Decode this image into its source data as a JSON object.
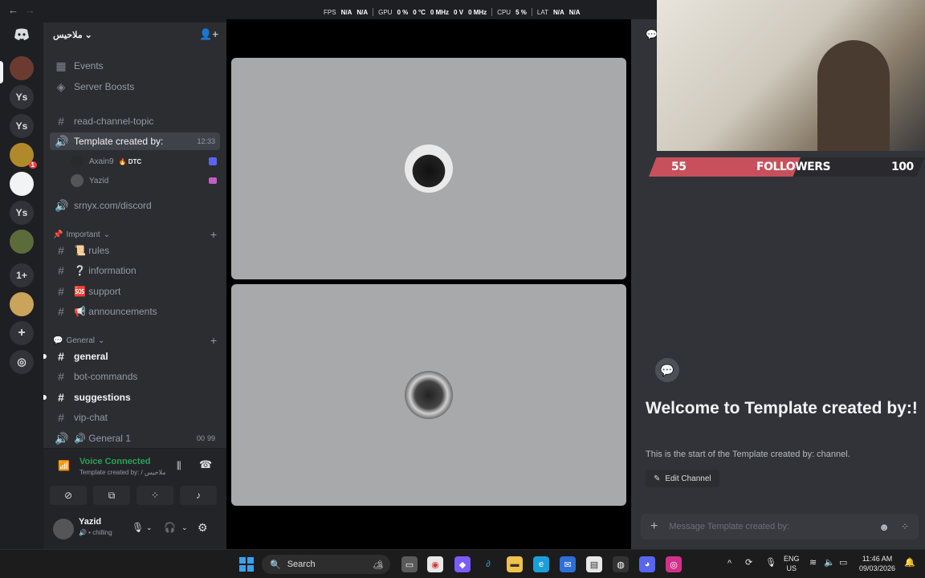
{
  "overlay": {
    "fps_label": "FPS",
    "fps_val1": "N/A",
    "fps_val2": "N/A",
    "gpu_label": "GPU",
    "gpu_load": "0 %",
    "gpu_temp": "0 °C",
    "gpu_clock": "0 MHz",
    "gpu_volt": "0 V",
    "gpu_mem": "0 MHz",
    "cpu_label": "CPU",
    "cpu_load": "5 %",
    "lat_label": "LAT",
    "lat_val1": "N/A",
    "lat_val2": "N/A"
  },
  "rail": {
    "servers": [
      "Ys",
      "Ys",
      "Ys",
      "1+"
    ],
    "badge": "1"
  },
  "server": {
    "name": "ملاحيس"
  },
  "sidebar": {
    "events": "Events",
    "boosts": "Server Boosts",
    "ch_read_topic": "read-channel-topic",
    "ch_template": "Template created by:",
    "ch_template_time": "12:33",
    "voice_users": [
      {
        "name": "Axain9",
        "tag": "DTC"
      },
      {
        "name": "Yazid"
      }
    ],
    "ch_srnyx": "srnyx.com/discord",
    "cat_important": "Important",
    "ch_rules": "📜 rules",
    "ch_information": "❔ information",
    "ch_support": "🆘 support",
    "ch_announcements": "📢 announcements",
    "cat_general": "General",
    "ch_general": "general",
    "ch_bot_commands": "bot-commands",
    "ch_suggestions": "suggestions",
    "ch_vip_chat": "vip-chat",
    "ch_general1": "🔊 General 1",
    "ch_general1_count1": "00",
    "ch_general1_count2": "99"
  },
  "voice_panel": {
    "title": "Voice Connected",
    "subtitle": "Template created by: / ملاحيس"
  },
  "user_panel": {
    "name": "Yazid",
    "status": "chilling"
  },
  "stream_overlay": {
    "followers_current": "55",
    "followers_label": "FOLLOWERS",
    "followers_goal": "100",
    "followers_progress": 0.55
  },
  "chat": {
    "welcome_title": "Welcome to Template created by:!",
    "welcome_desc": "This is the start of the Template created by: channel.",
    "edit_channel": "Edit Channel",
    "composer_placeholder": "Message Template created by:"
  },
  "taskbar": {
    "search": "Search",
    "lang1": "ENG",
    "lang2": "US",
    "time": "11:46 AM",
    "date": "09/03/2026"
  },
  "colors": {
    "accent_green": "#23a55a",
    "follower_bar": "#c7505c",
    "sidebar_bg": "#2b2d31",
    "chat_bg": "#313338"
  }
}
